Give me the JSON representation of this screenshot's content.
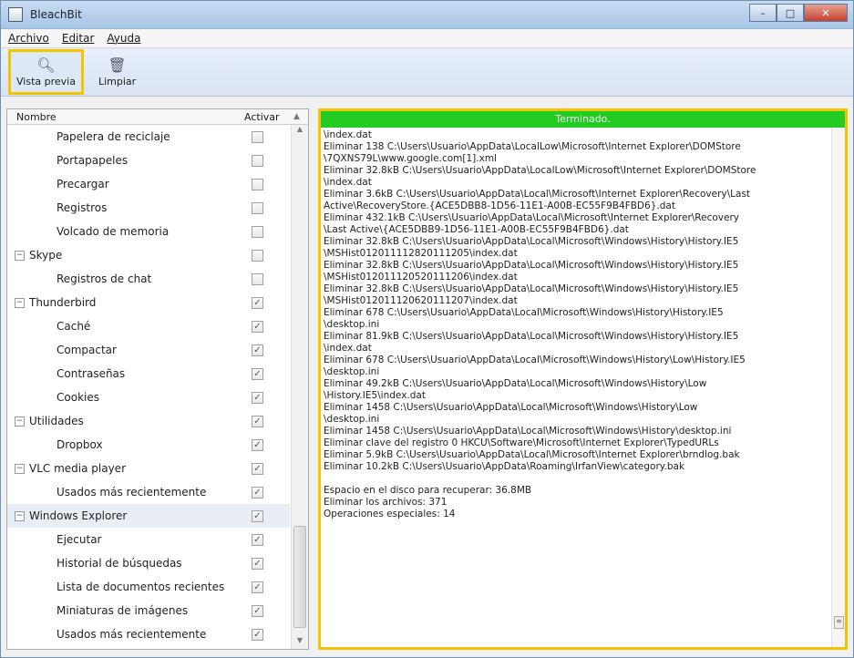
{
  "window": {
    "title": "BleachBit"
  },
  "menu": {
    "items": [
      "Archivo",
      "Editar",
      "Ayuda"
    ]
  },
  "toolbar": {
    "preview_label": "Vista previa",
    "clean_label": "Limpiar",
    "preview_icon": "magnifier-icon",
    "clean_icon": "trash-can-icon"
  },
  "columns": {
    "name": "Nombre",
    "active": "Activar"
  },
  "tree": [
    {
      "label": "Papelera de reciclaje",
      "level": 2,
      "checked": false
    },
    {
      "label": "Portapapeles",
      "level": 2,
      "checked": false
    },
    {
      "label": "Precargar",
      "level": 2,
      "checked": false
    },
    {
      "label": "Registros",
      "level": 2,
      "checked": false
    },
    {
      "label": "Volcado de memoria",
      "level": 2,
      "checked": false
    },
    {
      "label": "Skype",
      "level": 1,
      "checked": false
    },
    {
      "label": "Registros de chat",
      "level": 2,
      "checked": false
    },
    {
      "label": "Thunderbird",
      "level": 1,
      "checked": true
    },
    {
      "label": "Caché",
      "level": 2,
      "checked": true
    },
    {
      "label": "Compactar",
      "level": 2,
      "checked": true
    },
    {
      "label": "Contraseñas",
      "level": 2,
      "checked": true
    },
    {
      "label": "Cookies",
      "level": 2,
      "checked": true
    },
    {
      "label": "Utilidades",
      "level": 1,
      "checked": true
    },
    {
      "label": "Dropbox",
      "level": 2,
      "checked": true
    },
    {
      "label": "VLC media player",
      "level": 1,
      "checked": true
    },
    {
      "label": "Usados más recientemente",
      "level": 2,
      "checked": true
    },
    {
      "label": "Windows Explorer",
      "level": 1,
      "checked": true,
      "selected": true
    },
    {
      "label": "Ejecutar",
      "level": 2,
      "checked": true
    },
    {
      "label": "Historial de búsquedas",
      "level": 2,
      "checked": true
    },
    {
      "label": "Lista de documentos recientes",
      "level": 2,
      "checked": true
    },
    {
      "label": "Miniaturas de imágenes",
      "level": 2,
      "checked": true
    },
    {
      "label": "Usados más recientemente",
      "level": 2,
      "checked": true
    }
  ],
  "progress": {
    "text": "Terminado."
  },
  "log": [
    "\\index.dat",
    "Eliminar 138 C:\\Users\\Usuario\\AppData\\LocalLow\\Microsoft\\Internet Explorer\\DOMStore",
    "\\7QXNS79L\\www.google.com[1].xml",
    "Eliminar 32.8kB C:\\Users\\Usuario\\AppData\\LocalLow\\Microsoft\\Internet Explorer\\DOMStore",
    "\\index.dat",
    "Eliminar 3.6kB C:\\Users\\Usuario\\AppData\\Local\\Microsoft\\Internet Explorer\\Recovery\\Last",
    "Active\\RecoveryStore.{ACE5DBB8-1D56-11E1-A00B-EC55F9B4FBD6}.dat",
    "Eliminar 432.1kB C:\\Users\\Usuario\\AppData\\Local\\Microsoft\\Internet Explorer\\Recovery",
    "\\Last Active\\{ACE5DBB9-1D56-11E1-A00B-EC55F9B4FBD6}.dat",
    "Eliminar 32.8kB C:\\Users\\Usuario\\AppData\\Local\\Microsoft\\Windows\\History\\History.IE5",
    "\\MSHist012011112820111205\\index.dat",
    "Eliminar 32.8kB C:\\Users\\Usuario\\AppData\\Local\\Microsoft\\Windows\\History\\History.IE5",
    "\\MSHist012011120520111206\\index.dat",
    "Eliminar 32.8kB C:\\Users\\Usuario\\AppData\\Local\\Microsoft\\Windows\\History\\History.IE5",
    "\\MSHist012011120620111207\\index.dat",
    "Eliminar 678 C:\\Users\\Usuario\\AppData\\Local\\Microsoft\\Windows\\History\\History.IE5",
    "\\desktop.ini",
    "Eliminar 81.9kB C:\\Users\\Usuario\\AppData\\Local\\Microsoft\\Windows\\History\\History.IE5",
    "\\index.dat",
    "Eliminar 678 C:\\Users\\Usuario\\AppData\\Local\\Microsoft\\Windows\\History\\Low\\History.IE5",
    "\\desktop.ini",
    "Eliminar 49.2kB C:\\Users\\Usuario\\AppData\\Local\\Microsoft\\Windows\\History\\Low",
    "\\History.IE5\\index.dat",
    "Eliminar 1458 C:\\Users\\Usuario\\AppData\\Local\\Microsoft\\Windows\\History\\Low",
    "\\desktop.ini",
    "Eliminar 1458 C:\\Users\\Usuario\\AppData\\Local\\Microsoft\\Windows\\History\\desktop.ini",
    "Eliminar clave del registro 0 HKCU\\Software\\Microsoft\\Internet Explorer\\TypedURLs",
    "Eliminar 5.9kB C:\\Users\\Usuario\\AppData\\Local\\Microsoft\\Internet Explorer\\brndlog.bak",
    "Eliminar 10.2kB C:\\Users\\Usuario\\AppData\\Roaming\\IrfanView\\category.bak",
    "",
    "Espacio en el disco para recuperar: 36.8MB",
    "Eliminar los archivos: 371",
    "Operaciones especiales: 14"
  ]
}
